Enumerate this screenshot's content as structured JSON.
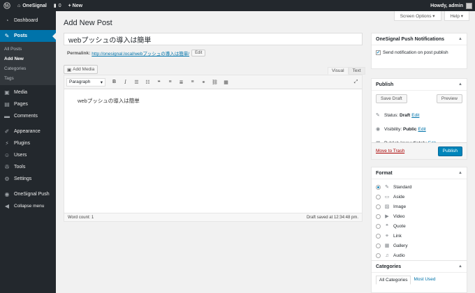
{
  "adminbar": {
    "site": "OneSignal",
    "comments": "0",
    "new": "+ New",
    "howdy": "Howdy, admin"
  },
  "sidebar": {
    "items": [
      {
        "label": "Dashboard",
        "icon": "dashboard-icon"
      },
      {
        "label": "Posts",
        "icon": "pin-icon"
      },
      {
        "label": "Media",
        "icon": "media-icon"
      },
      {
        "label": "Pages",
        "icon": "page-icon"
      },
      {
        "label": "Comments",
        "icon": "comment-icon"
      },
      {
        "label": "Appearance",
        "icon": "brush-icon"
      },
      {
        "label": "Plugins",
        "icon": "plugin-icon"
      },
      {
        "label": "Users",
        "icon": "user-icon"
      },
      {
        "label": "Tools",
        "icon": "wrench-icon"
      },
      {
        "label": "Settings",
        "icon": "settings-icon"
      },
      {
        "label": "OneSignal Push",
        "icon": "onesignal-icon"
      },
      {
        "label": "Collapse menu",
        "icon": "collapse-icon"
      }
    ],
    "submenu": [
      "All Posts",
      "Add New",
      "Categories",
      "Tags"
    ]
  },
  "screen_options": "Screen Options ▾",
  "help": "Help ▾",
  "page_title": "Add New Post",
  "post_title": "webプッシュの導入は簡単",
  "permalink": {
    "label": "Permalink:",
    "url": "http://onesignal.local/webプッシュの導入は簡単/",
    "edit": "Edit"
  },
  "add_media": "Add Media",
  "editor_tabs": {
    "visual": "Visual",
    "text": "Text"
  },
  "toolbar": {
    "format": "Paragraph"
  },
  "content": "webプッシュの導入は簡単",
  "footer": {
    "word_count": "Word count: 1",
    "draft_saved": "Draft saved at 12:34:48 pm."
  },
  "onesignal_box": {
    "title": "OneSignal Push Notifications",
    "checkbox": "Send notification on post publish"
  },
  "publish_box": {
    "title": "Publish",
    "save_draft": "Save Draft",
    "preview": "Preview",
    "status_label": "Status:",
    "status": "Draft",
    "visibility_label": "Visibility:",
    "visibility": "Public",
    "publish_label": "Publish",
    "publish_when": "immediately",
    "edit": "Edit",
    "trash": "Move to Trash",
    "publish": "Publish"
  },
  "format_box": {
    "title": "Format",
    "options": [
      "Standard",
      "Aside",
      "Image",
      "Video",
      "Quote",
      "Link",
      "Gallery",
      "Audio"
    ]
  },
  "categories_box": {
    "title": "Categories",
    "tabs": [
      "All Categories",
      "Most Used"
    ]
  }
}
